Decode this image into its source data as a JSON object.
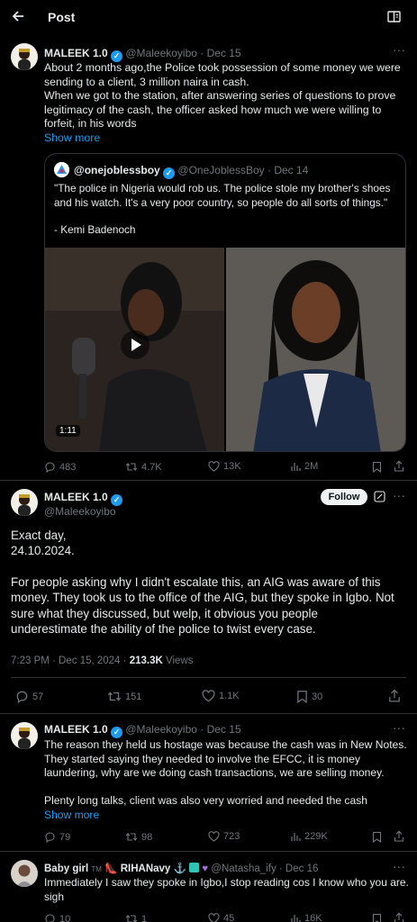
{
  "header": {
    "title": "Post"
  },
  "main_tweet": {
    "display_name": "MALEEK 1.0",
    "handle": "@Maleekoyibo",
    "date": "· Dec 15",
    "text_lines": [
      "About 2 months ago,the Police took possession of some money we were",
      "sending to a client, 3 million naira in cash.",
      "When we got to the station, after answering series of questions to prove",
      "legitimacy of the cash, the officer asked how much we were willing to",
      "forfeit, in his words"
    ],
    "show_more": "Show more",
    "quote": {
      "display_name": "@onejoblessboy",
      "handle": "@OneJoblessBoy",
      "date": "· Dec 14",
      "text_lines": [
        "\"The police in Nigeria would rob us. The police stole my brother's shoes",
        "and his watch. It's a very poor country, so people do all sorts of things.\""
      ],
      "attribution": "- Kemi Badenoch",
      "video_duration": "1:11"
    },
    "stats": {
      "replies": "483",
      "reposts": "4.7K",
      "likes": "13K",
      "views": "2M"
    }
  },
  "reply_tweet": {
    "display_name": "MALEEK 1.0",
    "handle": "@Maleekoyibo",
    "follow_label": "Follow",
    "line1": "Exact day,",
    "line2": "24.10.2024.",
    "body_lines": [
      "For people asking why I didn't escalate this, an AIG was aware of this",
      "money. They took us to the office of the AIG, but they spoke in Igbo. Not",
      "sure what they discussed, but welp, it obvious you people",
      "underestimate the ability of the police to twist every case."
    ],
    "timestamp": "7:23 PM · Dec 15, 2024 ·",
    "views_count": "213.3K",
    "views_label": "Views",
    "stats": {
      "replies": "57",
      "reposts": "151",
      "likes": "1.1K",
      "bookmarks": "30"
    }
  },
  "thread_tweet": {
    "display_name": "MALEEK 1.0",
    "handle": "@Maleekoyibo",
    "date": "· Dec 15",
    "text_lines": [
      "The reason they held us hostage was because the cash was in New Notes.",
      "They started saying they needed to involve the EFCC, it is money",
      "laundering, why are we doing cash transactions, we are selling money.",
      "",
      "Plenty long talks, client was also very worried and needed the cash"
    ],
    "show_more": "Show more",
    "stats": {
      "replies": "79",
      "reposts": "98",
      "likes": "723",
      "views": "229K"
    }
  },
  "last_tweet": {
    "display_name": "Baby girl",
    "name_suffix": "TM",
    "name_suffix2": "RIHANavy",
    "handle": "@Natasha_ify",
    "date": "· Dec 16",
    "text_lines": [
      "Immediately I saw they spoke in Igbo,I stop reading cos I know who you are.",
      "sigh"
    ],
    "stats": {
      "replies": "10",
      "reposts": "1",
      "likes": "45",
      "views": "16K"
    }
  },
  "colors": {
    "accent": "#1d9bf0",
    "background": "#000000",
    "muted": "#71767b",
    "divider": "#2f3336"
  }
}
